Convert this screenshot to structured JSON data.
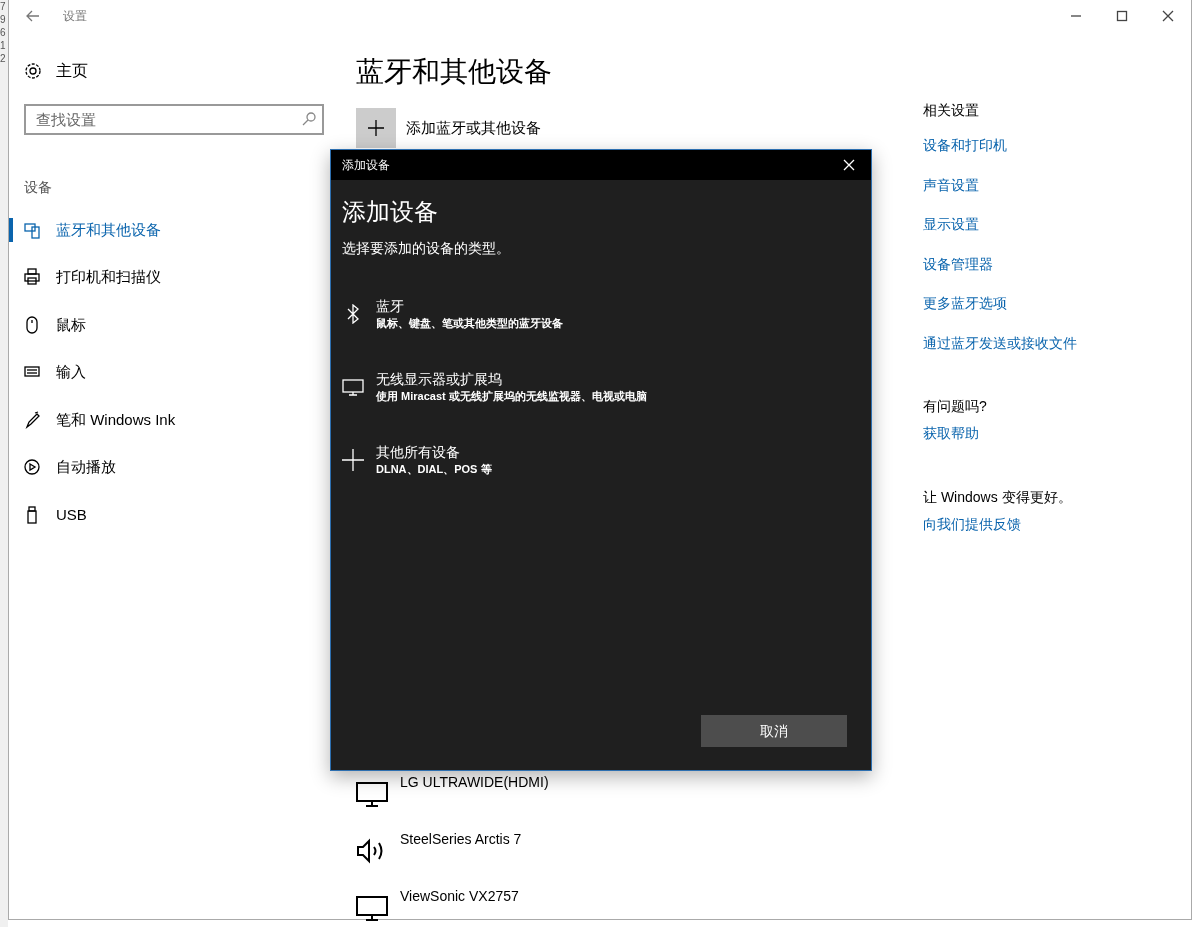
{
  "edge_digits": [
    "7",
    "9",
    "6",
    "1",
    "2"
  ],
  "window": {
    "title": "设置"
  },
  "sidebar": {
    "home": "主页",
    "search": {
      "placeholder": "查找设置"
    },
    "section": "设备",
    "items": [
      {
        "label": "蓝牙和其他设备",
        "kind": "devices",
        "selected": true
      },
      {
        "label": "打印机和扫描仪",
        "kind": "printer",
        "selected": false
      },
      {
        "label": "鼠标",
        "kind": "mouse",
        "selected": false
      },
      {
        "label": "输入",
        "kind": "keyboard",
        "selected": false
      },
      {
        "label": "笔和 Windows Ink",
        "kind": "pen",
        "selected": false
      },
      {
        "label": "自动播放",
        "kind": "autoplay",
        "selected": false
      },
      {
        "label": "USB",
        "kind": "usb",
        "selected": false
      }
    ]
  },
  "main": {
    "title": "蓝牙和其他设备",
    "add_button": "添加蓝牙或其他设备",
    "devices": [
      {
        "name": "LG ULTRAWIDE(HDMI)",
        "kind": "monitor"
      },
      {
        "name": "SteelSeries Arctis 7",
        "kind": "audio"
      },
      {
        "name": "ViewSonic VX2757",
        "kind": "monitor"
      }
    ]
  },
  "related": {
    "heading": "相关设置",
    "links": [
      "设备和打印机",
      "声音设置",
      "显示设置",
      "设备管理器",
      "更多蓝牙选项",
      "通过蓝牙发送或接收文件"
    ]
  },
  "help": {
    "heading": "有问题吗?",
    "link": "获取帮助"
  },
  "feedback": {
    "heading": "让 Windows 变得更好。",
    "link": "向我们提供反馈"
  },
  "dialog": {
    "title": "添加设备",
    "heading": "添加设备",
    "prompt": "选择要添加的设备的类型。",
    "options": [
      {
        "kind": "bluetooth",
        "title": "蓝牙",
        "description": "鼠标、键盘、笔或其他类型的蓝牙设备"
      },
      {
        "kind": "display",
        "title": "无线显示器或扩展坞",
        "description": "使用 Miracast 或无线扩展坞的无线监视器、电视或电脑"
      },
      {
        "kind": "other",
        "title": "其他所有设备",
        "description": "DLNA、DIAL、POS 等"
      }
    ],
    "cancel": "取消"
  }
}
